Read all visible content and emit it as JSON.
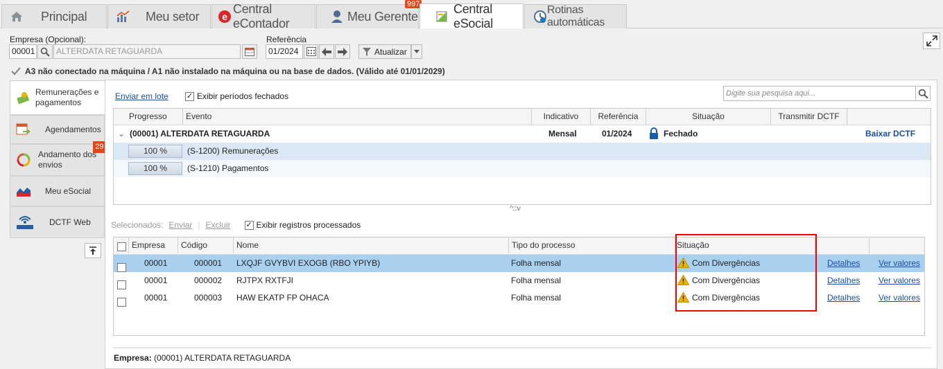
{
  "tabs": [
    {
      "label": "Principal",
      "icon": "home-icon"
    },
    {
      "label": "Meu setor",
      "icon": "chart-icon"
    },
    {
      "label": "Central eContador",
      "icon": "econtador-icon"
    },
    {
      "label": "Meu Gerente",
      "icon": "user-icon"
    },
    {
      "label": "Central eSocial",
      "icon": "esocial-icon",
      "active": true
    },
    {
      "label": "Rotinas automáticas",
      "icon": "clock-icon"
    }
  ],
  "notification_badge": "997",
  "filters": {
    "empresa_label": "Empresa (Opcional):",
    "empresa_code": "00001",
    "empresa_name": "ALTERDATA RETAGUARDA",
    "referencia_label": "Referência",
    "referencia_value": "01/2024",
    "atualizar_label": "Atualizar"
  },
  "certificate_warning": "A3 não conectado na máquina / A1 não instalado na máquina ou na base de dados. (Válido até 01/01/2029)",
  "sidebar": [
    {
      "label": "Remunerações e pagamentos",
      "icon": "money-icon",
      "active": true
    },
    {
      "label": "Agendamentos",
      "icon": "calendar-arrow-icon"
    },
    {
      "label": "Andamento dos envios",
      "icon": "refresh-icon",
      "badge": "29"
    },
    {
      "label": "Meu eSocial",
      "icon": "area-chart-icon"
    },
    {
      "label": "DCTF Web",
      "icon": "dctfweb-icon"
    }
  ],
  "toolbar": {
    "enviar_lote": "Enviar em lote",
    "exibir_fechados": "Exibir períodos fechados",
    "search_placeholder": "Digite sua pesquisa aqui..."
  },
  "top_grid": {
    "columns": [
      "Progresso",
      "Evento",
      "Indicativo",
      "Referência",
      "Situação",
      "Transmitir DCTF"
    ],
    "group": {
      "title": "(00001) ALTERDATA RETAGUARDA",
      "indicativo": "Mensal",
      "referencia": "01/2024",
      "situacao": "Fechado",
      "action": "Baixar DCTF"
    },
    "rows": [
      {
        "progress": "100 %",
        "progress_value": 1.0,
        "evento": "(S-1200) Remunerações"
      },
      {
        "progress": "100 %",
        "progress_value": 1.0,
        "evento": "(S-1210) Pagamentos"
      }
    ]
  },
  "bottom_toolbar": {
    "selecionados": "Selecionados:",
    "enviar": "Enviar",
    "excluir": "Excluir",
    "exibir_processados": "Exibir registros processados"
  },
  "bottom_grid": {
    "columns": [
      "Empresa",
      "Código",
      "Nome",
      "Tipo do processo",
      "Situação"
    ],
    "rows": [
      {
        "empresa": "00001",
        "codigo": "000001",
        "nome": "LXQJF GVYBVI EXOGB (RBO YPIYB)",
        "tipo": "Folha mensal",
        "situacao": "Com Divergências",
        "detalhes": "Detalhes",
        "ver": "Ver valores"
      },
      {
        "empresa": "00001",
        "codigo": "000002",
        "nome": "RJTPX RXTFJI",
        "tipo": "Folha mensal",
        "situacao": "Com Divergências",
        "detalhes": "Detalhes",
        "ver": "Ver valores"
      },
      {
        "empresa": "00001",
        "codigo": "000003",
        "nome": "HAW EKATP FP OHACA",
        "tipo": "Folha mensal",
        "situacao": "Com Divergências",
        "detalhes": "Detalhes",
        "ver": "Ver valores"
      }
    ]
  },
  "footer": {
    "label": "Empresa:",
    "value": "(00001) ALTERDATA RETAGUARDA"
  },
  "colors": {
    "selected_row": "#a9d0ef",
    "group_row_alt": "#dbe8f6",
    "link": "#1a4fa0",
    "highlight_box": "#e00000",
    "badge": "#e2471a"
  }
}
